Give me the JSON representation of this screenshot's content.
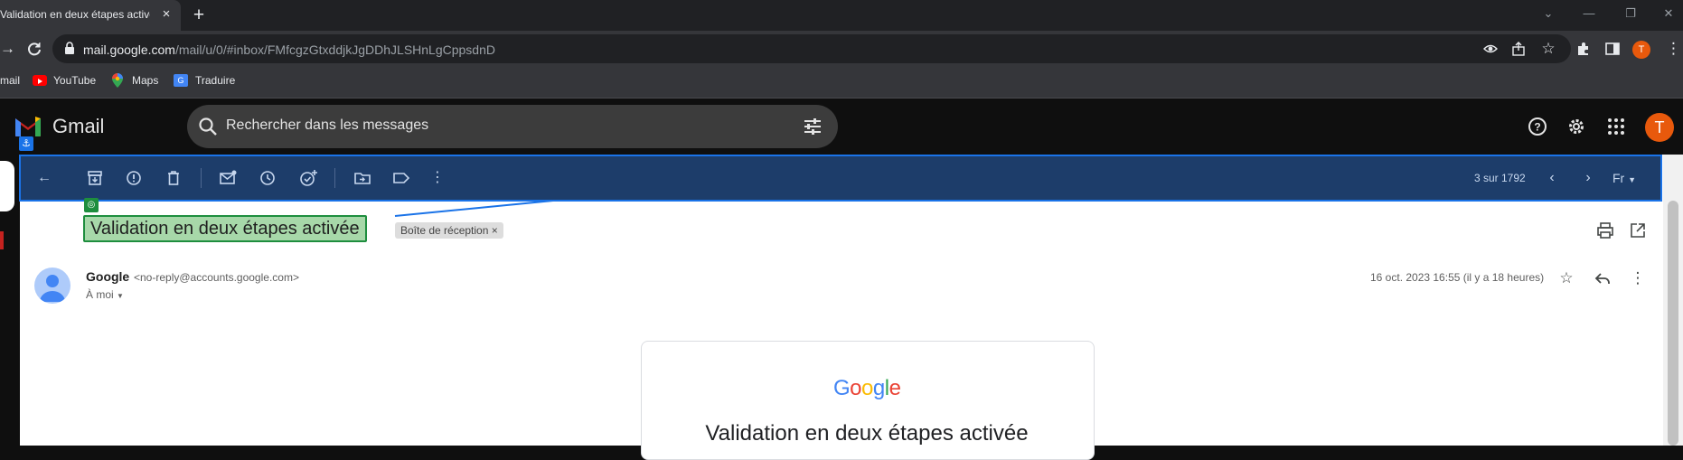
{
  "browser": {
    "tab_title": "Validation en deux étapes activée",
    "tab_close": "×",
    "new_tab": "+",
    "window_controls": [
      "⌄",
      "—",
      "❐",
      "✕"
    ],
    "url_host": "mail.google.com",
    "url_path": "/mail/u/0/#inbox/FMfcgzGtxddjkJgDDhJLSHnLgCppsdnD",
    "profile_initial": "T",
    "bookmarks": [
      {
        "label": "mail",
        "icon": "gmail-icon"
      },
      {
        "label": "YouTube",
        "icon": "youtube-icon"
      },
      {
        "label": "Maps",
        "icon": "maps-icon"
      },
      {
        "label": "Traduire",
        "icon": "translate-icon"
      }
    ]
  },
  "gmail": {
    "product_name": "Gmail",
    "search_placeholder": "Rechercher dans les messages",
    "account_initial": "T",
    "toolbar": {
      "icons": [
        "back-arrow-icon",
        "archive-icon",
        "report-spam-icon",
        "delete-icon",
        "mark-unread-icon",
        "snooze-icon",
        "add-task-icon",
        "move-to-icon",
        "label-icon",
        "more-icon"
      ],
      "page_count": "3 sur 1792",
      "input_tools": "Fr"
    },
    "message": {
      "subject": "Validation en deux étapes activée",
      "label_chip": "Boîte de réception",
      "label_chip_close": "×",
      "sender_name": "Google",
      "sender_email": "<no-reply@accounts.google.com>",
      "recipient": "À moi",
      "date": "16 oct. 2023 16:55 (il y a 18 heures)",
      "card_logo": "Google",
      "card_title": "Validation en deux étapes activée"
    }
  },
  "colors": {
    "highlight_blue": "#1a73e8",
    "highlight_green": "#1e8e3e",
    "avatar_orange": "#e8590c"
  }
}
